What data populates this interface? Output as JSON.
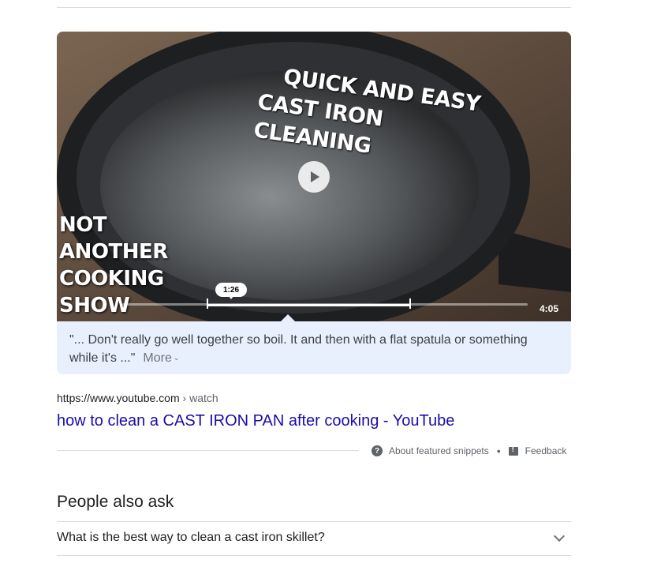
{
  "video": {
    "overlay_title_line1": "QUICK AND EASY",
    "overlay_title_line2": "CAST IRON CLEANING",
    "overlay_show": [
      "NOT",
      "ANOTHER",
      "COOKING",
      "SHOW"
    ],
    "timestamp": "1:26",
    "duration": "4:05",
    "progress_start_fraction": 0.21,
    "progress_end_fraction": 0.71
  },
  "caption": {
    "text": "\"... Don't really go well together so boil. It and then with a flat spatula or something while it's ...\"",
    "more_label": "More"
  },
  "result": {
    "url_domain": "https://www.youtube.com",
    "url_crumb": " › watch",
    "title": "how to clean a CAST IRON PAN after cooking - YouTube"
  },
  "snippet_footer": {
    "about_label": "About featured snippets",
    "separator": "•",
    "feedback_label": "Feedback"
  },
  "people_also_ask": {
    "heading": "People also ask",
    "questions": [
      "What is the best way to clean a cast iron skillet?"
    ]
  },
  "colors": {
    "link": "#1a0dab",
    "caption_bg": "#e8f0fe",
    "divider": "#dadce0"
  }
}
